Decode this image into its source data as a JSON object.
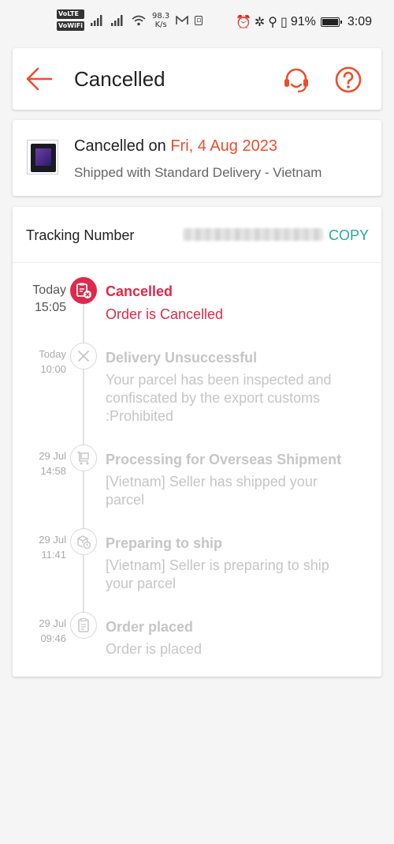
{
  "status_bar": {
    "badge_volte": "VoLTE",
    "badge_vowifi": "VoWiFi",
    "speed_value": "98.3",
    "speed_unit": "K/s",
    "battery": "91%",
    "battery_level": 0.91,
    "time": "3:09"
  },
  "header": {
    "title": "Cancelled",
    "accent_color": "#ee4d2d"
  },
  "summary": {
    "status_prefix": "Cancelled on ",
    "date": "Fri, 4 Aug 2023",
    "shipping_text": "Shipped with Standard Delivery - Vietnam"
  },
  "tracking": {
    "label": "Tracking Number",
    "copy_label": "COPY",
    "events": [
      {
        "day": "Today",
        "time": "15:05",
        "title": "Cancelled",
        "desc": "Order is Cancelled",
        "icon": "cancelled-clipboard-icon",
        "active": true
      },
      {
        "day": "Today",
        "time": "10:00",
        "title": "Delivery Unsuccessful",
        "desc": "Your parcel has been inspected and confiscated by the export customs :Prohibited",
        "icon": "x-circle-icon",
        "active": false
      },
      {
        "day": "29 Jul",
        "time": "14:58",
        "title": "Processing for Overseas Shipment",
        "desc": "[Vietnam] Seller has shipped your parcel",
        "icon": "cart-icon",
        "active": false
      },
      {
        "day": "29 Jul",
        "time": "11:41",
        "title": "Preparing to ship",
        "desc": "[Vietnam] Seller is preparing to ship your parcel",
        "icon": "box-clock-icon",
        "active": false
      },
      {
        "day": "29 Jul",
        "time": "09:46",
        "title": "Order placed",
        "desc": "Order is placed",
        "icon": "receipt-icon",
        "active": false
      }
    ]
  }
}
